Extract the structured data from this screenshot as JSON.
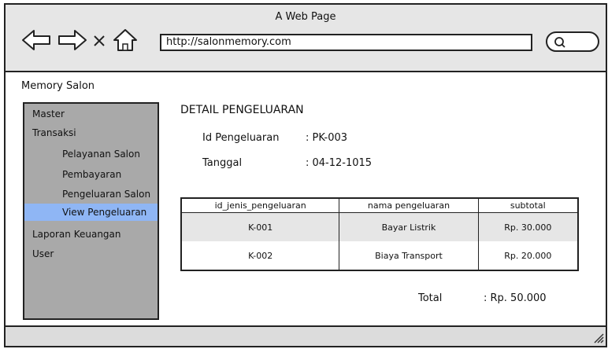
{
  "browser": {
    "title": "A Web Page",
    "url": "http://salonmemory.com"
  },
  "app": {
    "name": "Memory Salon"
  },
  "sidebar": {
    "items": [
      {
        "label": "Master",
        "level": 0,
        "active": false
      },
      {
        "label": "Transaksi",
        "level": 0,
        "active": false
      },
      {
        "label": "Pelayanan Salon",
        "level": 1,
        "active": false
      },
      {
        "label": "Pembayaran",
        "level": 1,
        "active": false
      },
      {
        "label": "Pengeluaran Salon",
        "level": 1,
        "active": false
      },
      {
        "label": "View Pengeluaran",
        "level": 1,
        "active": true
      },
      {
        "label": "Laporan Keuangan",
        "level": 0,
        "active": false
      },
      {
        "label": "User",
        "level": 0,
        "active": false
      }
    ]
  },
  "detail": {
    "heading": "DETAIL PENGELUARAN",
    "fields": [
      {
        "label": "Id Pengeluaran",
        "value": ": PK-003"
      },
      {
        "label": "Tanggal",
        "value": ": 04-12-1015"
      }
    ]
  },
  "table": {
    "columns": [
      "id_jenis_pengeluaran",
      "nama pengeluaran",
      "subtotal"
    ],
    "rows": [
      [
        "K-001",
        "Bayar Listrik",
        "Rp. 30.000"
      ],
      [
        "K-002",
        "Biaya Transport",
        "Rp. 20.000"
      ]
    ]
  },
  "total": {
    "label": "Total",
    "value": ": Rp. 50.000"
  },
  "colors": {
    "sidebar_bg": "#a9a9a9",
    "active_item": "#8fb6f5",
    "chrome": "#e6e6e6"
  }
}
